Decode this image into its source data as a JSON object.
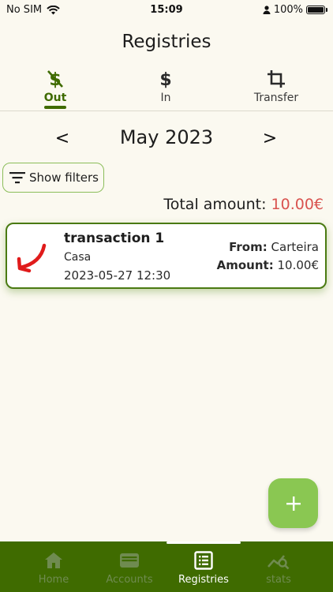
{
  "status_bar": {
    "carrier": "No SIM",
    "time": "15:09",
    "battery": "100%"
  },
  "header": {
    "title": "Registries"
  },
  "tabs": [
    {
      "label": "Out",
      "icon": "dollar-off-icon"
    },
    {
      "label": "In",
      "icon": "dollar-icon"
    },
    {
      "label": "Transfer",
      "icon": "crop-icon"
    }
  ],
  "month_nav": {
    "prev": "<",
    "label": "May 2023",
    "next": ">"
  },
  "filters": {
    "label": "Show filters"
  },
  "total": {
    "label": "Total amount:",
    "value": "10.00€"
  },
  "transactions": [
    {
      "name": "transaction 1",
      "account": "Casa",
      "datetime": "2023-05-27 12:30",
      "from_label": "From:",
      "from_value": "Carteira",
      "amount_label": "Amount:",
      "amount_value": "10.00€"
    }
  ],
  "fab": {
    "label": "+"
  },
  "bottom_nav": [
    {
      "label": "Home",
      "icon": "home-icon"
    },
    {
      "label": "Accounts",
      "icon": "wallet-icon"
    },
    {
      "label": "Registries",
      "icon": "list-icon"
    },
    {
      "label": "stats",
      "icon": "stats-icon"
    }
  ],
  "colors": {
    "primary": "#3f6b00",
    "accent": "#8ac752",
    "negative": "#d9534f",
    "background": "#fbf9f0"
  }
}
